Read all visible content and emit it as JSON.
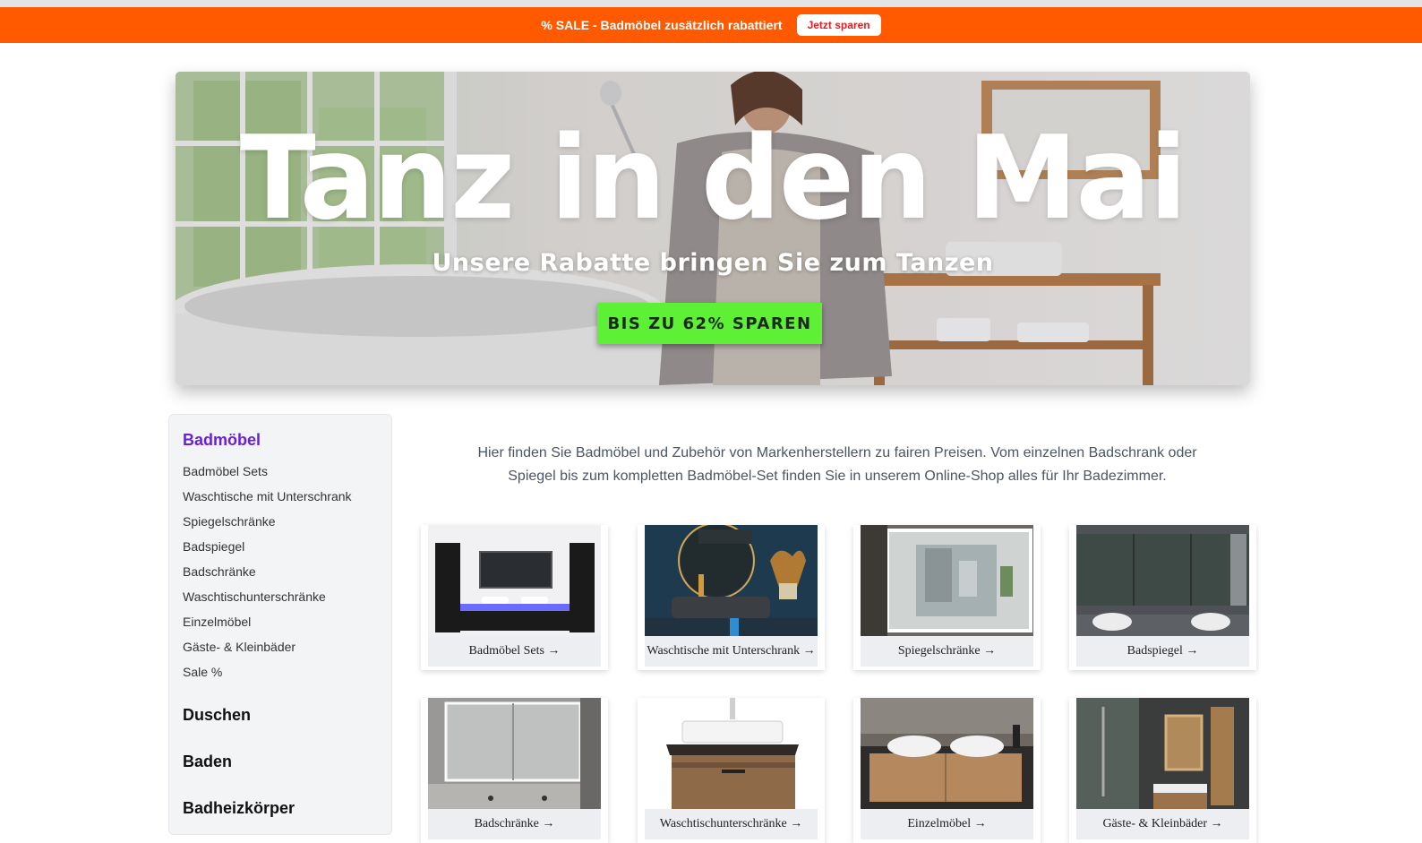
{
  "promo_bar": {
    "text": "% SALE - Badmöbel zusätzlich rabattiert",
    "button": "Jetzt sparen"
  },
  "hero": {
    "title": "Tanz in den Mai",
    "subtitle": "Unsere Rabatte bringen Sie zum Tanzen",
    "cta": "BIS ZU 62% SPAREN"
  },
  "sidebar": {
    "active_heading": "Badmöbel",
    "items": [
      "Badmöbel Sets",
      "Waschtische mit Unterschrank",
      "Spiegelschränke",
      "Badspiegel",
      "Badschränke",
      "Waschtischunterschränke",
      "Einzelmöbel",
      "Gäste- & Kleinbäder",
      "Sale %"
    ],
    "headings": [
      "Duschen",
      "Baden",
      "Badheizkörper"
    ]
  },
  "intro_text": "Hier finden Sie Badmöbel und Zubehör von Markenherstellern zu fairen Preisen. Vom einzelnen Badschrank oder Spiegel bis zum kompletten Badmöbel-Set finden Sie in unserem Online-Shop alles für Ihr Badezimmer.",
  "categories": [
    "Badmöbel Sets →",
    "Waschtische mit Unterschrank →",
    "Spiegelschränke →",
    "Badspiegel →",
    "Badschränke →",
    "Waschtischunterschränke →",
    "Einzelmöbel →",
    "Gäste- & Kleinbäder →"
  ],
  "colors": {
    "promo": "#ff5a00",
    "cta": "#5ef034",
    "active": "#6a1ee0"
  }
}
